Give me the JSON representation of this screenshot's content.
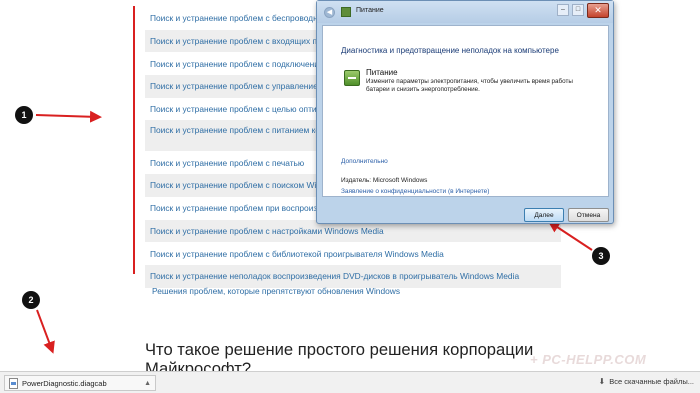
{
  "links": [
    "Поиск и устранение проблем с беспроводной сетевой адаптер",
    "Поиск и устранение проблем с входящих подключений",
    "Поиск и устранение проблем с подключением",
    "Поиск и устранение проблем с управлением сетевыми адаптерами",
    "Поиск и устранение проблем с целью оптимизации",
    "Поиск и устранение проблем с питанием компьютера для повышения его работы",
    "Поиск и устранение проблем с печатью",
    "Поиск и устранение проблем с поиском Windows",
    "Поиск и устранение проблем при воспроизведении",
    "Поиск и устранение проблем с настройками Windows Media",
    "Поиск и устранение проблем с библиотекой проигрывателя Windows Media",
    "Поиск и устранение неполадок воспроизведения DVD-дисков в проигрыватель Windows Media"
  ],
  "plain_link": "Решения проблем, которые препятствуют обновления Windows",
  "heading": "Что такое решение простого решения корпорации Майкрософт?",
  "watermark": "+ PC-HELPP.COM",
  "markers": [
    "1",
    "2",
    "3"
  ],
  "dialog": {
    "title": "Питание",
    "heading": "Диагностика и предотвращение неполадок на компьютере",
    "item_title": "Питание",
    "item_desc": "Измените параметры электропитания, чтобы увеличить время работы батареи и снизить энергопотребление.",
    "advanced": "Дополнительно",
    "publisher": "Издатель:   Microsoft Windows",
    "privacy": "Заявление о конфиденциальности (в Интернете)",
    "next_label": "Далее",
    "cancel_label": "Отмена"
  },
  "download_bar": {
    "filename": "PowerDiagnostic.diagcab",
    "all_downloads": "Все скачанные файлы..."
  },
  "colors": {
    "link": "#2f6ea5",
    "annotation_red": "#d92020"
  }
}
